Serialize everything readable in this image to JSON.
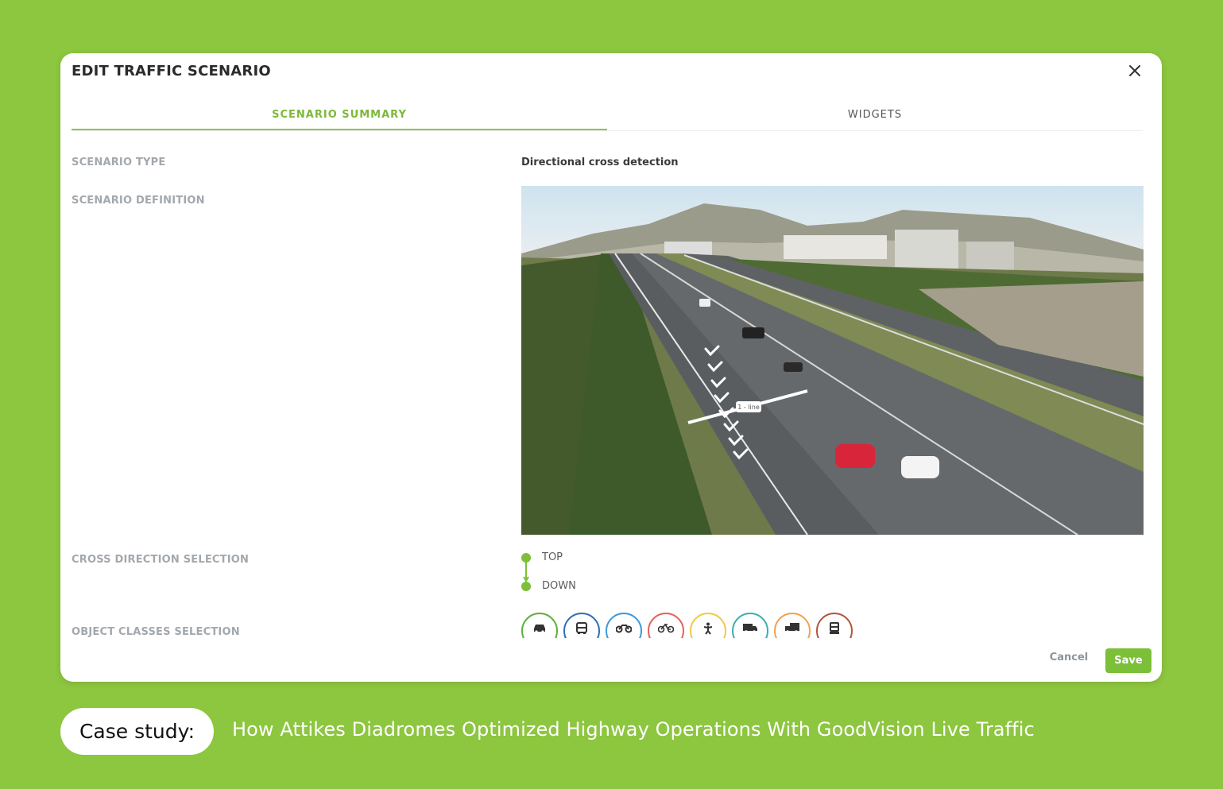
{
  "modal": {
    "title": "EDIT TRAFFIC SCENARIO",
    "tabs": [
      {
        "label": "SCENARIO SUMMARY",
        "active": true
      },
      {
        "label": "WIDGETS",
        "active": false
      }
    ],
    "rows": {
      "scenario_type": {
        "label": "SCENARIO TYPE",
        "value": "Directional cross detection"
      },
      "scenario_definition": {
        "label": "SCENARIO DEFINITION",
        "line_tag": "1 - line"
      },
      "cross_direction": {
        "label": "CROSS DIRECTION SELECTION",
        "options": [
          "TOP",
          "DOWN"
        ]
      },
      "object_classes": {
        "label": "OBJECT CLASSES SELECTION",
        "items": [
          {
            "icon": "car-icon",
            "color": "#5fae3c"
          },
          {
            "icon": "bus-icon",
            "color": "#2f6fb5"
          },
          {
            "icon": "motorbike-icon",
            "color": "#3d9ad8"
          },
          {
            "icon": "bicycle-icon",
            "color": "#e2645b"
          },
          {
            "icon": "pedestrian-icon",
            "color": "#f0c94a"
          },
          {
            "icon": "van-icon",
            "color": "#3bb0b0"
          },
          {
            "icon": "truck-icon",
            "color": "#f2a24e"
          },
          {
            "icon": "heavy-truck-icon",
            "color": "#b4553a"
          }
        ]
      }
    },
    "footer": {
      "cancel": "Cancel",
      "save": "Save"
    }
  },
  "banner": {
    "pill": "Case study:",
    "title": "How Attikes Diadromes Optimized Highway Operations With GoodVision Live Traffic"
  },
  "colors": {
    "accent": "#8dc63f",
    "background": "#8dc63f",
    "save": "#7cbf38"
  }
}
